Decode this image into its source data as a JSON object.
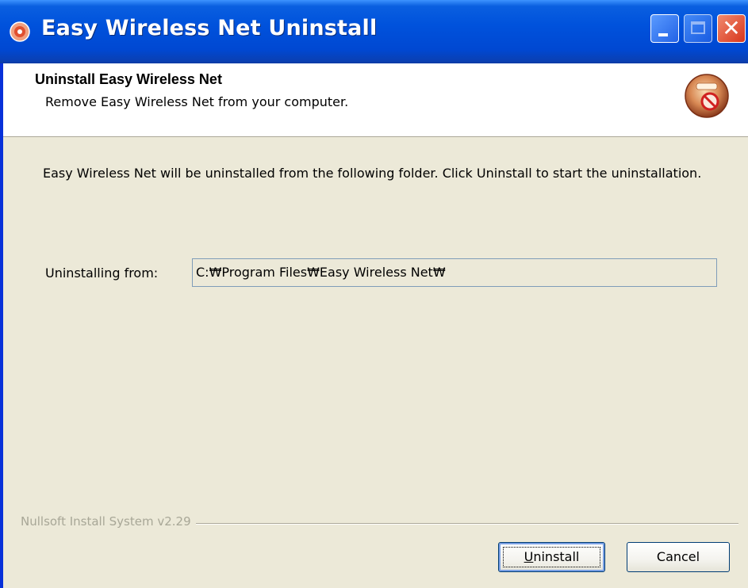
{
  "window": {
    "title": "Easy Wireless Net Uninstall",
    "title_icon": "installer-disc-icon",
    "controls": {
      "minimize_icon": "minimize-icon",
      "maximize_icon": "maximize-icon",
      "close_icon": "close-icon",
      "close_glyph": "✕"
    }
  },
  "header": {
    "title": "Uninstall Easy Wireless Net",
    "subtitle": "Remove Easy Wireless Net from your computer.",
    "icon": "uninstall-disc-icon"
  },
  "main": {
    "description": "Easy Wireless Net will be uninstalled from the following folder. Click Uninstall to start the uninstallation.",
    "folder_label": "Uninstalling from:",
    "folder_value": "C:₩Program Files₩Easy Wireless Net₩"
  },
  "footer": {
    "branding": "Nullsoft Install System v2.29",
    "uninstall_label_accel": "U",
    "uninstall_label_rest": "ninstall",
    "cancel_label": "Cancel"
  },
  "colors": {
    "titlebar": "#0052dc",
    "dialog_background": "#ece9d8",
    "header_background": "#ffffff",
    "close_button": "#d8361c",
    "branding_text": "#a8a797"
  }
}
